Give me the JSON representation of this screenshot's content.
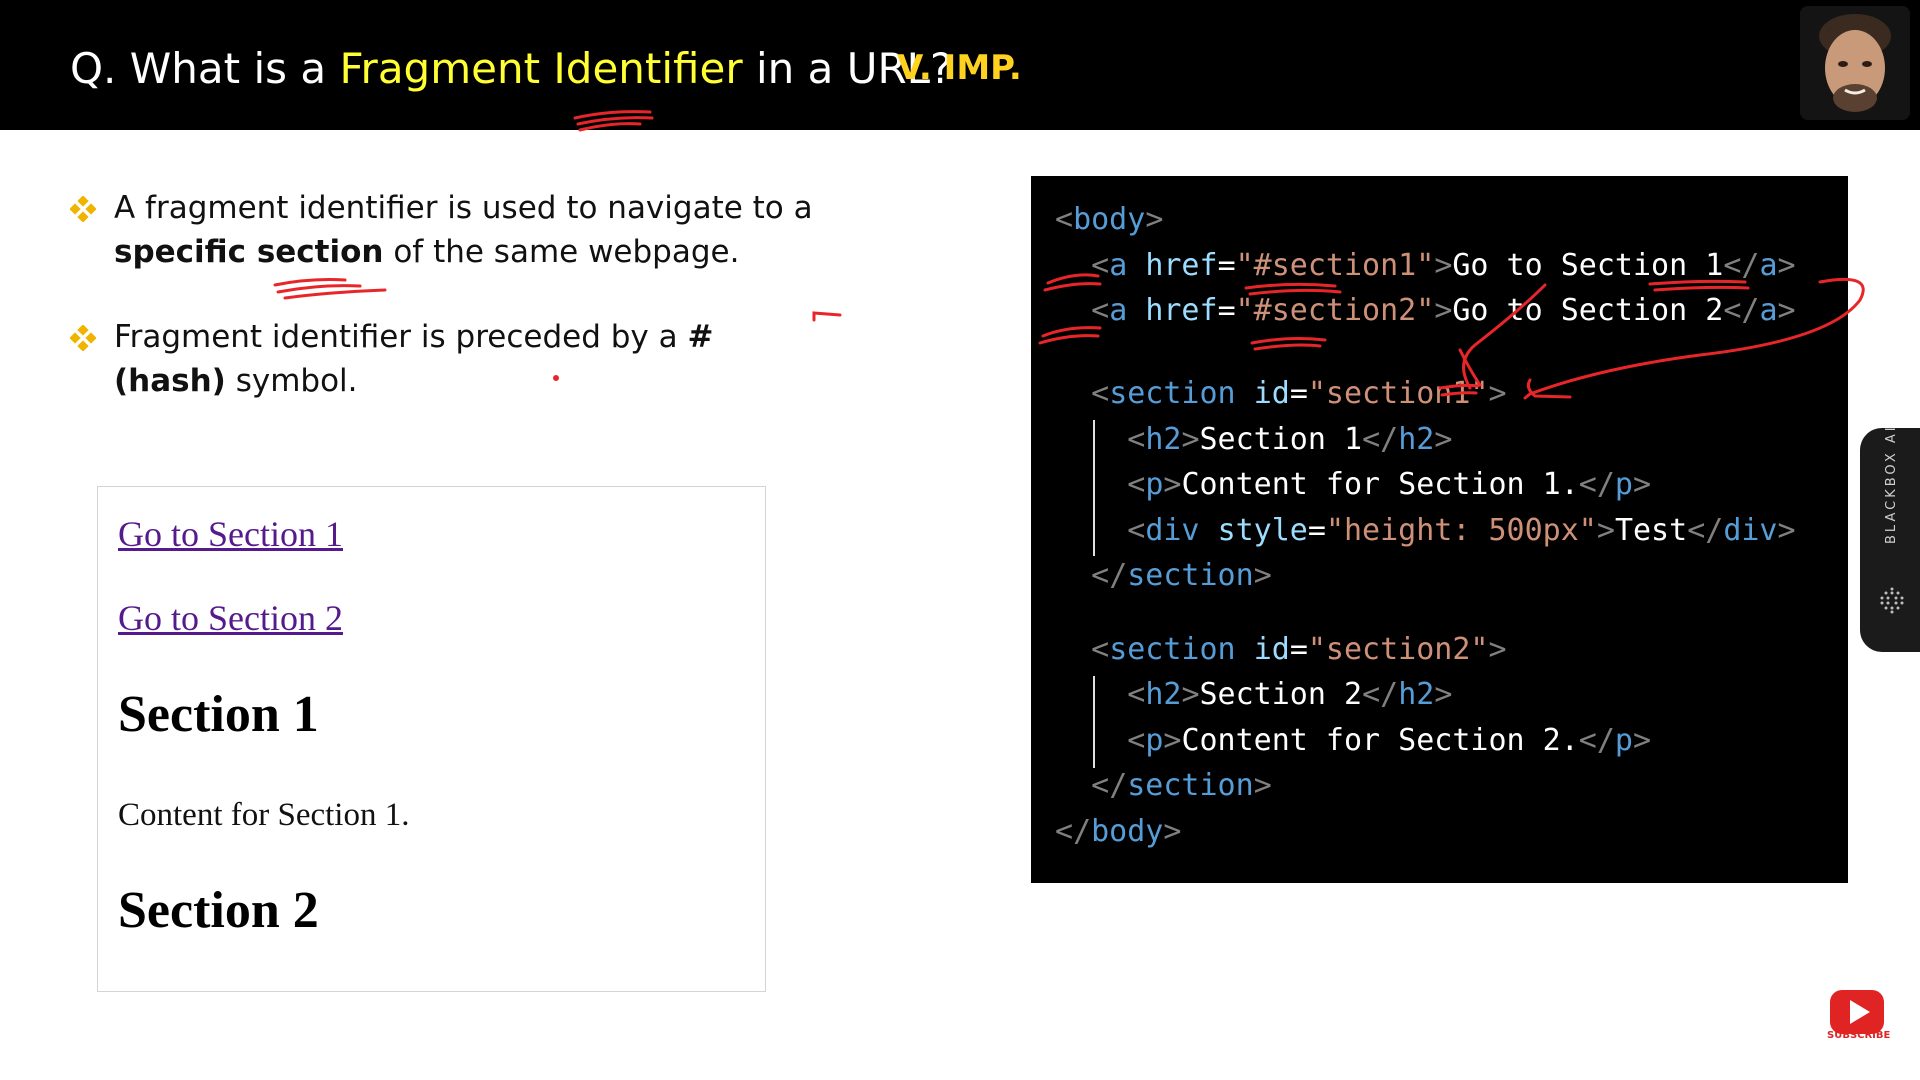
{
  "header": {
    "question_prefix": "Q. What is a ",
    "question_highlight": "Fragment Identifier",
    "question_suffix": " in a URL?",
    "badge": "V. IMP."
  },
  "bullets": [
    {
      "pre": "A fragment identifier is used to navigate to a ",
      "bold": "specific section",
      "post": " of the same webpage."
    },
    {
      "pre": "Fragment identifier is preceded by a ",
      "bold": "# (hash)",
      "post": " symbol."
    }
  ],
  "preview": {
    "link1": "Go to Section 1",
    "link2": "Go to Section 2",
    "heading1": "Section 1",
    "para1": "Content for Section 1.",
    "heading2": "Section 2"
  },
  "code_lines": [
    "<body>",
    "  <a href=\"#section1\">Go to Section 1</a>",
    "  <a href=\"#section2\">Go to Section 2</a>",
    "",
    "  <section id=\"section1\">",
    "    <h2>Section 1</h2>",
    "    <p>Content for Section 1.</p>",
    "    <div style=\"height: 500px\">Test</div>",
    "  </section>",
    "",
    "  <section id=\"section2\">",
    "    <h2>Section 2</h2>",
    "    <p>Content for Section 2.</p>",
    "  </section>",
    "</body>"
  ],
  "sidebar_tab": {
    "label": "BLACKBOX AI",
    "icon": "blackbox-logo-icon"
  },
  "subscribe": {
    "label": "SUBSCRIBE",
    "icon": "youtube-play-icon"
  },
  "colors": {
    "header_bg": "#000000",
    "highlight": "#ffff33",
    "badge": "#ffd21f",
    "bullet_diamond": "#f0b400",
    "link": "#551a8b",
    "code_bg": "#000000",
    "code_tag": "#569cd6",
    "code_attr": "#9cdcfe",
    "code_string": "#ce9178",
    "annotation": "#e8262a"
  }
}
